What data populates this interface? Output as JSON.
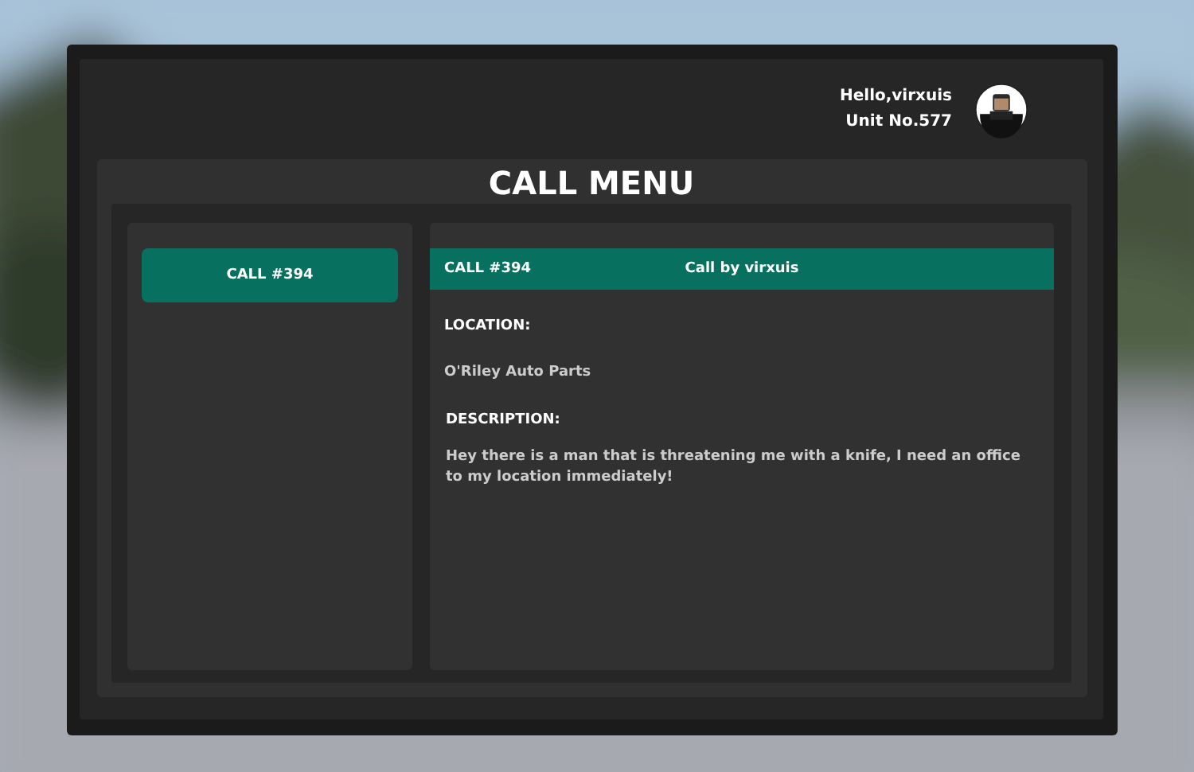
{
  "user": {
    "greeting": "Hello,virxuis",
    "unit": "Unit No.577"
  },
  "title": "CALL MENU",
  "calls": [
    {
      "label": "CALL #394",
      "selected": true
    }
  ],
  "detail": {
    "call_id": "CALL #394",
    "caller": "Call by virxuis",
    "location_label": "LOCATION:",
    "location": "O'Riley Auto Parts",
    "description_label": "DESCRIPTION:",
    "description": "Hey there is a man that is threatening me with a knife, I need an office to my location immediately!"
  }
}
